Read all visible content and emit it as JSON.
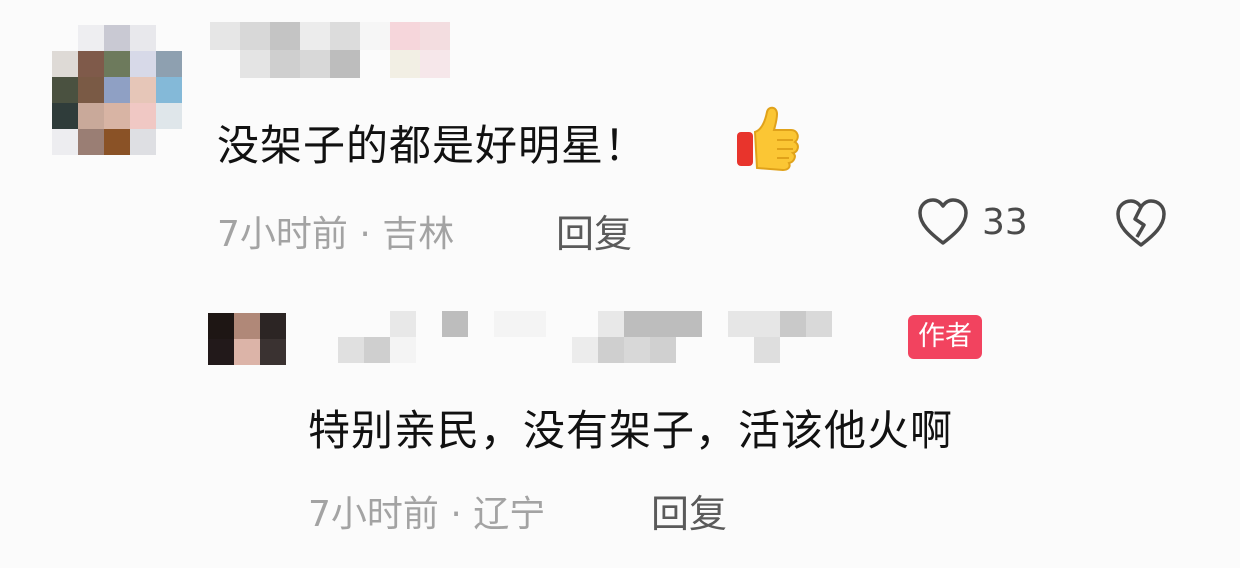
{
  "comment": {
    "text": "没架子的都是好明星！",
    "emoji_icon": "thumbs-up-icon",
    "time": "7小时前",
    "separator": " · ",
    "location": "吉林",
    "reply_label": "回复",
    "like_count": "33",
    "like_icon": "heart-outline-icon",
    "dislike_icon": "broken-heart-icon"
  },
  "reply": {
    "badge": "作者",
    "text": "特别亲民，没有架子，活该他火啊",
    "time": "7小时前",
    "separator": " · ",
    "location": "辽宁",
    "reply_label": "回复"
  },
  "colors": {
    "badge_bg": "#f2435f",
    "meta_text": "#a3a3a3",
    "background": "#fbfbfb"
  }
}
